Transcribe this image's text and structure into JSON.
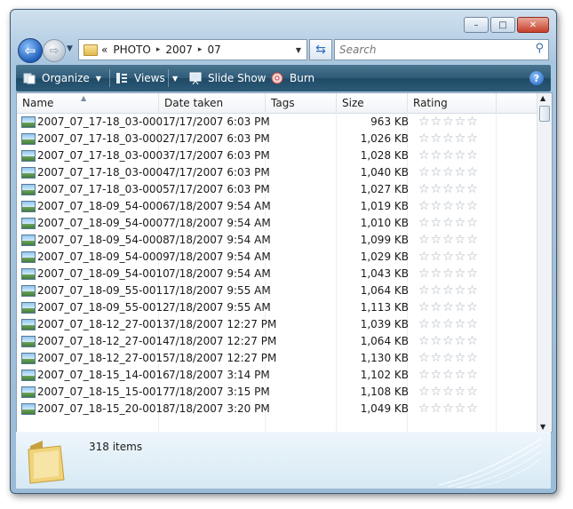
{
  "window": {
    "minimize_glyph": "–",
    "maximize_glyph": "□",
    "close_glyph": "✕"
  },
  "address": {
    "prefix": "«",
    "crumbs": [
      "PHOTO",
      "2007",
      "07"
    ],
    "separator": "▸",
    "dropdown_glyph": "▼"
  },
  "search": {
    "placeholder": "Search"
  },
  "toolbar": {
    "organize": "Organize",
    "views": "Views",
    "slideshow": "Slide Show",
    "burn": "Burn",
    "help": "?"
  },
  "columns": {
    "name": "Name",
    "date": "Date taken",
    "tags": "Tags",
    "size": "Size",
    "rating": "Rating"
  },
  "rating_stars": "☆☆☆☆☆",
  "files": [
    {
      "name": "2007_07_17-18_03-0001",
      "date": "7/17/2007 6:03 PM",
      "size": "963 KB"
    },
    {
      "name": "2007_07_17-18_03-0002",
      "date": "7/17/2007 6:03 PM",
      "size": "1,026 KB"
    },
    {
      "name": "2007_07_17-18_03-0003",
      "date": "7/17/2007 6:03 PM",
      "size": "1,028 KB"
    },
    {
      "name": "2007_07_17-18_03-0004",
      "date": "7/17/2007 6:03 PM",
      "size": "1,040 KB"
    },
    {
      "name": "2007_07_17-18_03-0005",
      "date": "7/17/2007 6:03 PM",
      "size": "1,027 KB"
    },
    {
      "name": "2007_07_18-09_54-0006",
      "date": "7/18/2007 9:54 AM",
      "size": "1,019 KB"
    },
    {
      "name": "2007_07_18-09_54-0007",
      "date": "7/18/2007 9:54 AM",
      "size": "1,010 KB"
    },
    {
      "name": "2007_07_18-09_54-0008",
      "date": "7/18/2007 9:54 AM",
      "size": "1,099 KB"
    },
    {
      "name": "2007_07_18-09_54-0009",
      "date": "7/18/2007 9:54 AM",
      "size": "1,029 KB"
    },
    {
      "name": "2007_07_18-09_54-0010",
      "date": "7/18/2007 9:54 AM",
      "size": "1,043 KB"
    },
    {
      "name": "2007_07_18-09_55-0011",
      "date": "7/18/2007 9:55 AM",
      "size": "1,064 KB"
    },
    {
      "name": "2007_07_18-09_55-0012",
      "date": "7/18/2007 9:55 AM",
      "size": "1,113 KB"
    },
    {
      "name": "2007_07_18-12_27-0013",
      "date": "7/18/2007 12:27 PM",
      "size": "1,039 KB"
    },
    {
      "name": "2007_07_18-12_27-0014",
      "date": "7/18/2007 12:27 PM",
      "size": "1,064 KB"
    },
    {
      "name": "2007_07_18-12_27-0015",
      "date": "7/18/2007 12:27 PM",
      "size": "1,130 KB"
    },
    {
      "name": "2007_07_18-15_14-0016",
      "date": "7/18/2007 3:14 PM",
      "size": "1,102 KB"
    },
    {
      "name": "2007_07_18-15_15-0017",
      "date": "7/18/2007 3:15 PM",
      "size": "1,108 KB"
    },
    {
      "name": "2007_07_18-15_20-0018",
      "date": "7/18/2007 3:20 PM",
      "size": "1,049 KB"
    }
  ],
  "details": {
    "item_count": "318 items"
  },
  "icons": {
    "folder": "folder-icon",
    "search": "search-icon",
    "refresh": "refresh-icon",
    "help": "help-icon"
  },
  "colors": {
    "toolbar": "#2f5b78",
    "back_button": "#1f5fb8",
    "close_button": "#c7402b"
  }
}
